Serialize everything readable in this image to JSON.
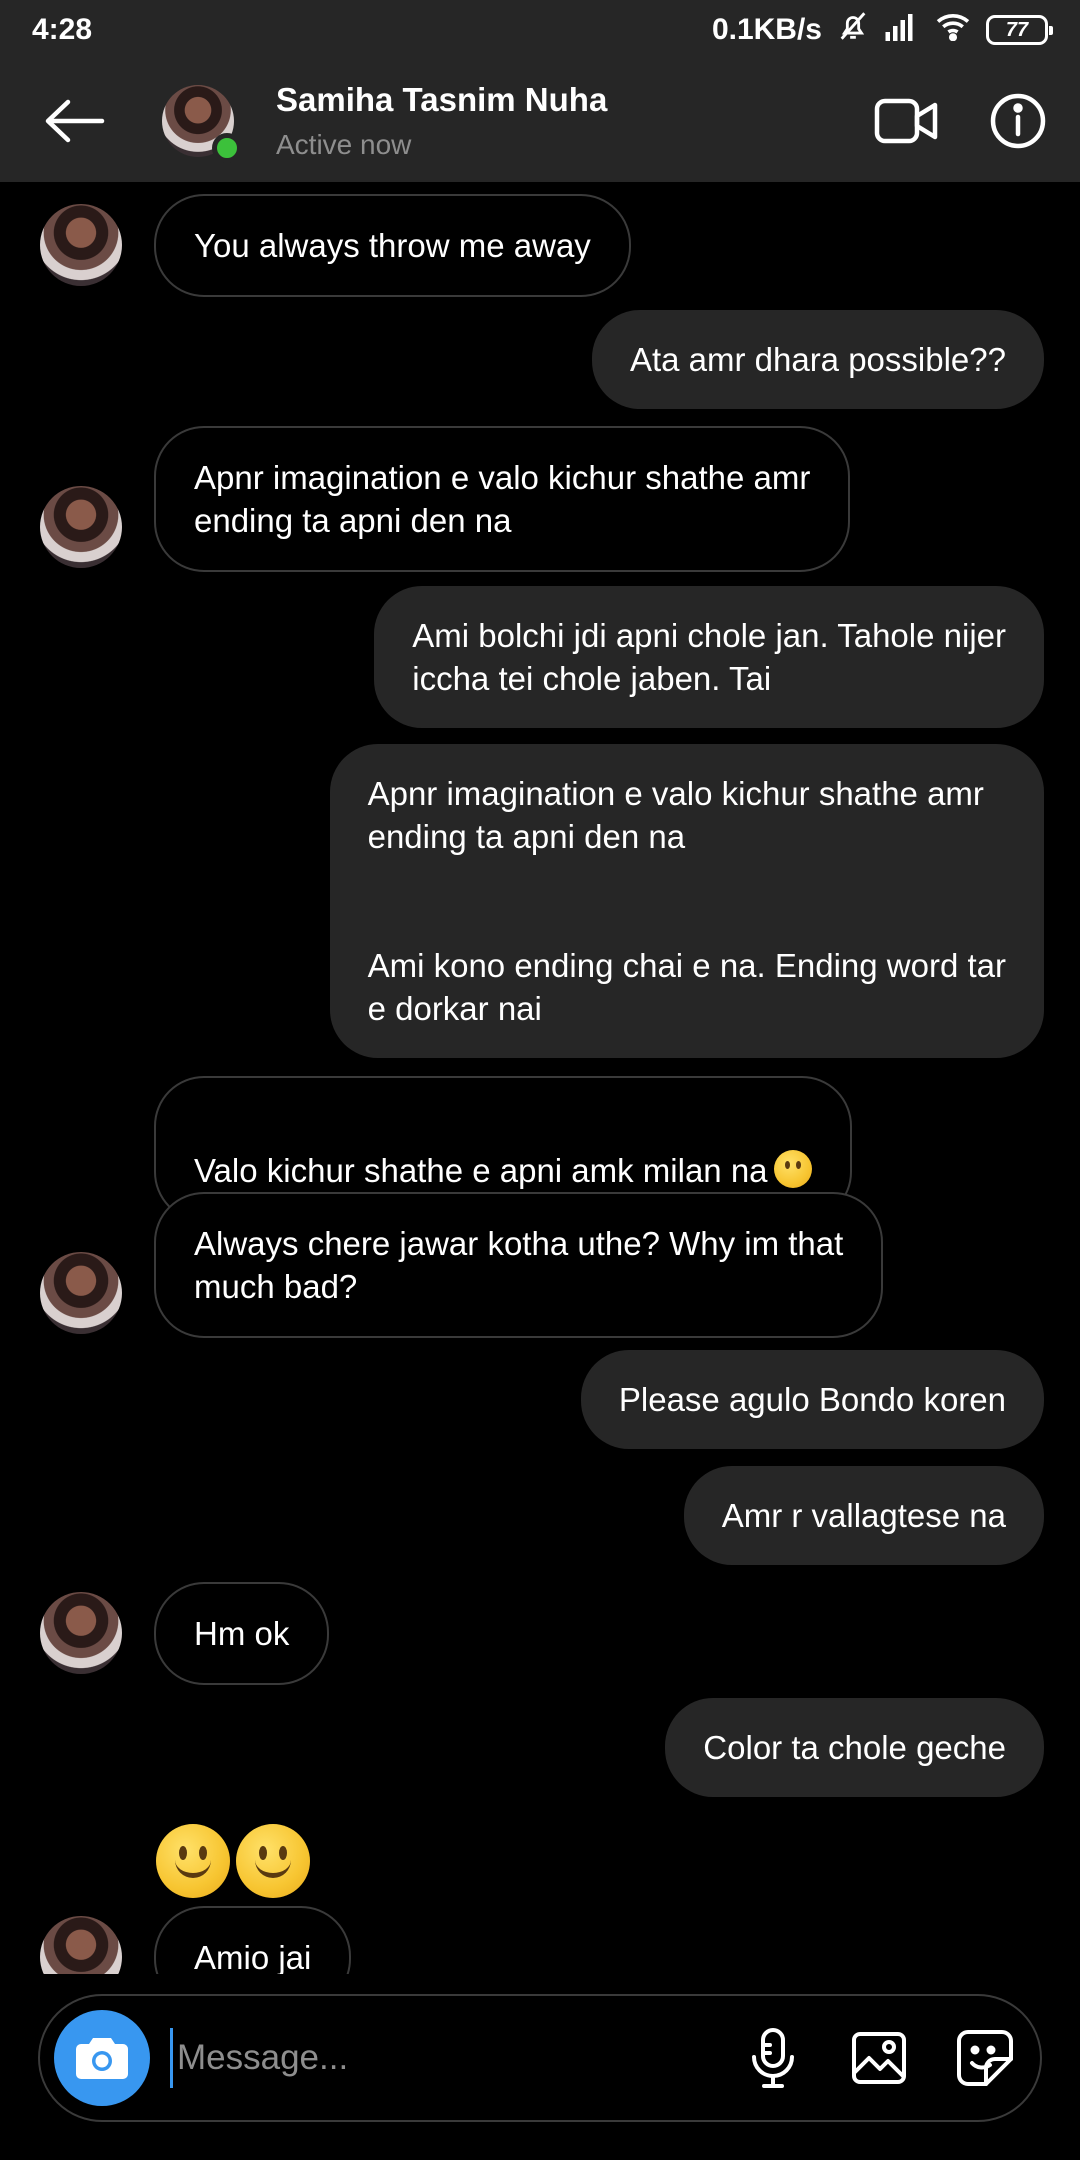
{
  "status_bar": {
    "time": "4:28",
    "network_speed": "0.1KB/s",
    "battery": "77",
    "icons": [
      "mute-icon",
      "signal-icon",
      "wifi-icon",
      "battery-icon"
    ]
  },
  "header": {
    "contact_name": "Samiha Tasnim Nuha",
    "contact_status": "Active now",
    "online_color": "#3cc13b",
    "icons": [
      "back-arrow-icon",
      "video-call-icon",
      "info-icon"
    ]
  },
  "messages": [
    {
      "side": "in",
      "text": "You always throw me away"
    },
    {
      "side": "out",
      "text": "Ata amr dhara possible??"
    },
    {
      "side": "in",
      "text": "Apnr imagination e valo kichur shathe amr\nending ta apni den na"
    },
    {
      "side": "out",
      "text": "Ami bolchi jdi apni chole jan. Tahole nijer\niccha tei chole jaben. Tai"
    },
    {
      "side": "out",
      "text": "Apnr imagination e valo kichur shathe amr\nending ta apni den na\n\n\nAmi kono ending chai e na. Ending word tar\ne dorkar nai"
    },
    {
      "side": "in",
      "text": "Valo kichur shathe e apni amk milan na"
    },
    {
      "side": "in",
      "text": "Always chere jawar kotha uthe? Why im that\nmuch bad?"
    },
    {
      "side": "out",
      "text": "Please agulo Bondo koren"
    },
    {
      "side": "out",
      "text": "Amr r vallagtese na"
    },
    {
      "side": "in",
      "text": "Hm ok"
    },
    {
      "side": "out",
      "text": "Color ta chole geche"
    },
    {
      "side": "in",
      "text": "Amio jai"
    }
  ],
  "composer": {
    "placeholder": "Message...",
    "value": "",
    "accent": "#3897f0",
    "icons": [
      "camera-icon",
      "microphone-icon",
      "gallery-icon",
      "sticker-icon"
    ]
  },
  "colors": {
    "background": "#000000",
    "header_bg": "#262626",
    "outgoing_bubble": "#262626",
    "incoming_border": "#3a3a3a"
  }
}
